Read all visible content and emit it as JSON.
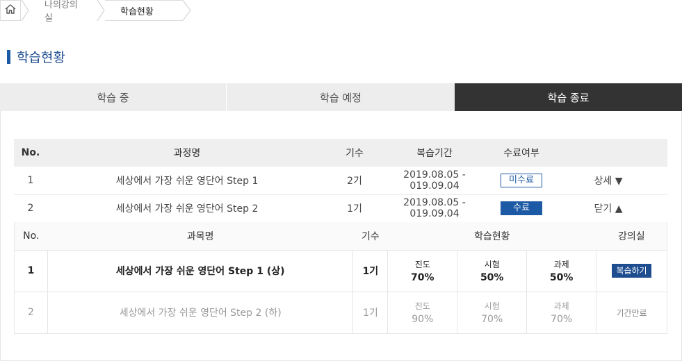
{
  "breadcrumb": {
    "home_icon": "home-icon",
    "items": [
      "나의강의실",
      "학습현황"
    ]
  },
  "page_title": "학습현황",
  "colors": {
    "accent": "#1d5aa5",
    "tab_active_bg": "#333333",
    "tab_bg": "#ededed"
  },
  "tabs": [
    {
      "label": "학습 중",
      "active": false
    },
    {
      "label": "학습 예정",
      "active": false
    },
    {
      "label": "학습 종료",
      "active": true
    }
  ],
  "courses": {
    "headers": [
      "No.",
      "과정명",
      "기수",
      "복습기간",
      "수료여부",
      ""
    ],
    "rows": [
      {
        "no": "1",
        "name": "세상에서 가장 쉬운 영단어 Step 1",
        "term": "2기",
        "period": "2019.08.05 - 019.09.04",
        "status": "미수료",
        "toggle": "상세 ▼"
      },
      {
        "no": "2",
        "name": "세상에서 가장 쉬운 영단어 Step 2",
        "term": "1기",
        "period": "2019.08.05 - 019.09.04",
        "status": "수료",
        "toggle": "닫기 ▲"
      }
    ]
  },
  "subjects": {
    "headers": [
      "No.",
      "과목명",
      "기수",
      "학습현황",
      "강의실"
    ],
    "rows": [
      {
        "no": "1",
        "name": "세상에서 가장 쉬운 영단어 Step 1 (상)",
        "term": "1기",
        "progress_label": "진도",
        "progress": "70%",
        "exam_label": "시험",
        "exam": "50%",
        "task_label": "과제",
        "task": "50%",
        "room": "복습하기"
      },
      {
        "no": "2",
        "name": "세상에서 가장 쉬운 영단어 Step 2 (하)",
        "term": "1기",
        "progress_label": "진도",
        "progress": "90%",
        "exam_label": "시험",
        "exam": "70%",
        "task_label": "과제",
        "task": "70%",
        "room": "기간만료"
      }
    ]
  }
}
